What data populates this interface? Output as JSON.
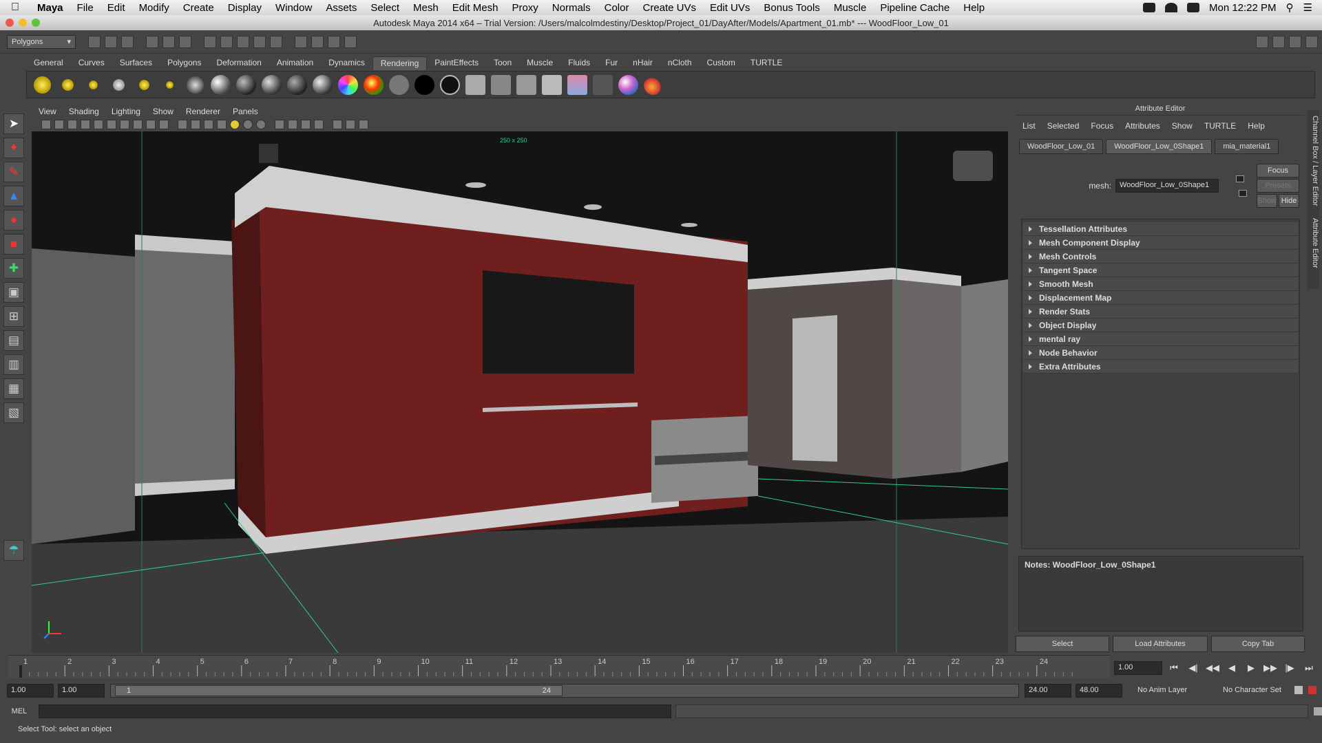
{
  "mac_menu": {
    "app": "Maya",
    "items": [
      "File",
      "Edit",
      "Modify",
      "Create",
      "Display",
      "Window",
      "Assets",
      "Select",
      "Mesh",
      "Edit Mesh",
      "Proxy",
      "Normals",
      "Color",
      "Create UVs",
      "Edit UVs",
      "Bonus Tools",
      "Muscle",
      "Pipeline Cache",
      "Help"
    ],
    "clock": "Mon 12:22 PM"
  },
  "title": "Autodesk Maya 2014 x64 – Trial Version: /Users/malcolmdestiny/Desktop/Project_01/DayAfter/Models/Apartment_01.mb*  ---  WoodFloor_Low_01",
  "status_line": {
    "menu_set": "Polygons"
  },
  "shelf_tabs": [
    {
      "label": "General"
    },
    {
      "label": "Curves"
    },
    {
      "label": "Surfaces"
    },
    {
      "label": "Polygons"
    },
    {
      "label": "Deformation"
    },
    {
      "label": "Animation"
    },
    {
      "label": "Dynamics"
    },
    {
      "label": "Rendering",
      "active": true
    },
    {
      "label": "PaintEffects"
    },
    {
      "label": "Toon"
    },
    {
      "label": "Muscle"
    },
    {
      "label": "Fluids"
    },
    {
      "label": "Fur"
    },
    {
      "label": "nHair"
    },
    {
      "label": "nCloth"
    },
    {
      "label": "Custom"
    },
    {
      "label": "TURTLE"
    }
  ],
  "viewport": {
    "menu": [
      "View",
      "Shading",
      "Lighting",
      "Show",
      "Renderer",
      "Panels"
    ],
    "resolution_label": "250 x 250",
    "colors": {
      "background": "#141414",
      "wall_red": "#6e1f1e",
      "floor": "#3a3a3a",
      "trim": "#c8c8c8",
      "grid_line": "#2fd08a"
    }
  },
  "attribute_editor": {
    "header": "Attribute Editor",
    "menu": [
      "List",
      "Selected",
      "Focus",
      "Attributes",
      "Show",
      "TURTLE",
      "Help"
    ],
    "tabs": [
      {
        "label": "WoodFloor_Low_01"
      },
      {
        "label": "WoodFloor_Low_0Shape1",
        "active": true
      },
      {
        "label": "mia_material1"
      }
    ],
    "mesh_label": "mesh:",
    "mesh_value": "WoodFloor_Low_0Shape1",
    "buttons": {
      "focus": "Focus",
      "presets": "Presets",
      "show": "Show",
      "hide": "Hide"
    },
    "sections": [
      "Tessellation Attributes",
      "Mesh Component Display",
      "Mesh Controls",
      "Tangent Space",
      "Smooth Mesh",
      "Displacement Map",
      "Render Stats",
      "Object Display",
      "mental ray",
      "Node Behavior",
      "Extra Attributes"
    ],
    "notes": "Notes:  WoodFloor_Low_0Shape1",
    "bottom_buttons": [
      "Select",
      "Load Attributes",
      "Copy Tab"
    ],
    "side_tabs": [
      "Channel Box / Layer Editor",
      "Attribute Editor"
    ]
  },
  "time_slider": {
    "ticks": [
      "1",
      "2",
      "3",
      "4",
      "5",
      "6",
      "7",
      "8",
      "9",
      "10",
      "11",
      "12",
      "13",
      "14",
      "15",
      "16",
      "17",
      "18",
      "19",
      "20",
      "21",
      "22",
      "23",
      "24"
    ],
    "current_frame": "1.00"
  },
  "range_slider": {
    "start": "1.00",
    "playback_start": "1.00",
    "range_start_label": "1",
    "range_end_label": "24",
    "playback_end": "24.00",
    "end": "48.00",
    "anim_layer": "No Anim Layer",
    "character_set": "No Character Set"
  },
  "command_line": {
    "label": "MEL"
  },
  "help_line": "Select Tool: select an object"
}
